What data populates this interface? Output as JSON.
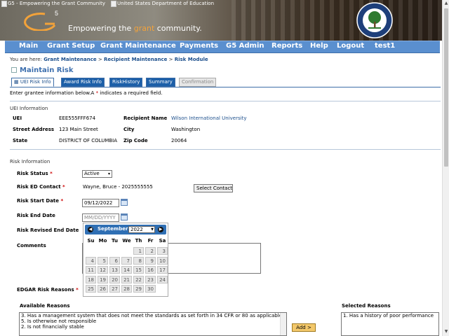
{
  "header": {
    "logo_alt": "G5 - Empowering the Grant Community",
    "ed_alt": "United States Department of Education",
    "tagline_prefix": "Empowering the ",
    "tagline_highlight": "grant",
    "tagline_suffix": " community.",
    "seal_text": "DEPARTMENT OF EDUCATION"
  },
  "nav": {
    "items": [
      "Main",
      "Grant Setup",
      "Grant Maintenance",
      "Payments",
      "G5 Admin",
      "Reports",
      "Help",
      "Logout",
      "test1"
    ]
  },
  "breadcrumb": {
    "prefix": "You are here: ",
    "crumbs": [
      "Grant Maintenance",
      "Recipient Maintenance",
      "Risk Module"
    ],
    "separator": " > "
  },
  "page_title": "Maintain Risk",
  "tabs": [
    {
      "label": "UEI Risk Info",
      "state": "active"
    },
    {
      "label": "Award Risk Info",
      "state": "normal"
    },
    {
      "label": "RiskHistory",
      "state": "normal"
    },
    {
      "label": "Summary",
      "state": "normal"
    },
    {
      "label": "Confirmation",
      "state": "disabled"
    }
  ],
  "instructions": {
    "before": "Enter grantee information below.A ",
    "star": "*",
    "after": " indicates a required field."
  },
  "uei_info": {
    "heading": "UEI Information",
    "uei_label": "UEI",
    "uei_value": "EEE555FFF674",
    "recipient_label": "Recipient Name",
    "recipient_value": "Wilson International University",
    "street_label": "Street Address",
    "street_value": "123 Main Street",
    "city_label": "City",
    "city_value": "Washington",
    "state_label": "State",
    "state_value": "DISTRICT OF COLUMBIA",
    "zip_label": "Zip Code",
    "zip_value": "20064"
  },
  "risk_info": {
    "heading": "Risk Information",
    "status_label": "Risk Status",
    "status_value": "Active",
    "contact_label": "Risk ED Contact",
    "contact_value": "Wayne, Bruce - 2025555555",
    "select_contact_button": "Select Contact",
    "start_label": "Risk Start Date",
    "start_value": "09/12/2022",
    "end_label": "Risk End Date",
    "end_placeholder": "MM/DD/YYYY",
    "revised_label": "Risk Revised End Date",
    "comments_label": "Comments",
    "reasons_label": "EDGAR Risk Reasons",
    "required_mark": "*"
  },
  "datepicker": {
    "month": "September",
    "year": "2022",
    "prev": "◀",
    "next": "▶",
    "dow": [
      "Su",
      "Mo",
      "Tu",
      "We",
      "Th",
      "Fr",
      "Sa"
    ],
    "first_weekday": 4,
    "days_in_month": 30
  },
  "reasons": {
    "available_label": "Available Reasons",
    "available": [
      "3. Has a management system that does not meet the standards as set forth in 34 CFR or 80 as applicable",
      "5. Is otherwise not responsible",
      "2. Is not financially stable"
    ],
    "selected_label": "Selected Reasons",
    "selected": [
      "1. Has a history of poor performance"
    ],
    "add_button": "Add >"
  }
}
